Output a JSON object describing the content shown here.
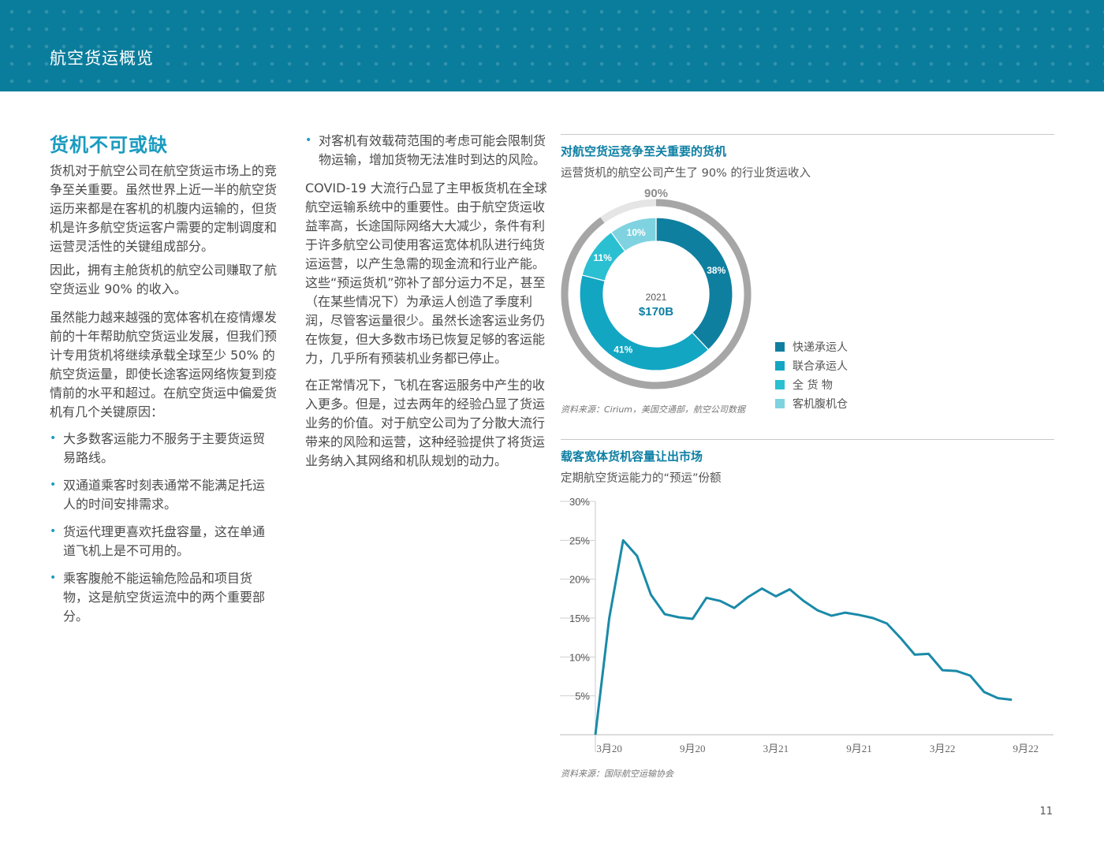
{
  "header": {
    "title": "航空货运概览"
  },
  "section": {
    "heading": "货机不可或缺",
    "para1": "货机对于航空公司在航空货运市场上的竞争至关重要。虽然世界上近一半的航空货运历来都是在客机的机腹内运输的，但货机是许多航空货运客户需要的定制调度和运营灵活性的关键组成部分。",
    "para2": "因此，拥有主舱货机的航空公司赚取了航空货运业 90% 的收入。",
    "para3": "虽然能力越来越强的宽体客机在疫情爆发前的十年帮助航空货运业发展，但我们预计专用货机将继续承载全球至少 50% 的航空货运量，即使长途客运网络恢复到疫情前的水平和超过。在航空货运中偏爱货机有几个关键原因：",
    "bullets": [
      "大多数客运能力不服务于主要货运贸易路线。",
      "双通道乘客时刻表通常不能满足托运人的时间安排需求。",
      "货运代理更喜欢托盘容量，这在单通道飞机上是不可用的。",
      "乘客腹舱不能运输危险品和项目货物，这是航空货运流中的两个重要部分。"
    ]
  },
  "col2": {
    "bullet": "对客机有效载荷范围的考虑可能会限制货物运输，增加货物无法准时到达的风险。",
    "para1": "COVID-19 大流行凸显了主甲板货机在全球航空运输系统中的重要性。由于航空货运收益率高，长途国际网络大大减少，条件有利于许多航空公司使用客运宽体机队进行纯货运运营，以产生急需的现金流和行业产能。这些“预运货机”弥补了部分运力不足，甚至（在某些情况下）为承运人创造了季度利润，尽管客运量很少。虽然长途客运业务仍在恢复，但大多数市场已恢复足够的客运能力，几乎所有预装机业务都已停止。",
    "para2": "在正常情况下，飞机在客运服务中产生的收入更多。但是，过去两年的经验凸显了货运业务的价值。对于航空公司为了分散大流行带来的风险和运营，这种经验提供了将货运业务纳入其网络和机队规划的动力。"
  },
  "donut": {
    "title": "对航空货运竞争至关重要的货机",
    "subtitle": "运营货机的航空公司产生了 90% 的行业货运收入",
    "outer_label": "90%",
    "center_year": "2021",
    "center_value": "$170B",
    "source": "资料来源：Cirium，美国交通部，航空公司数据"
  },
  "line": {
    "title": "载客宽体货机容量让出市场",
    "subtitle": "定期航空货运能力的“预运”份额",
    "source": "资料来源：国际航空运输协会"
  },
  "chart_data": [
    {
      "type": "pie",
      "title": "对航空货运竞争至关重要的货机",
      "categories": [
        "快递承运人",
        "联合承运人",
        "全 货 物",
        "客机腹机仓"
      ],
      "values": [
        38,
        41,
        11,
        10
      ],
      "labels": [
        "38%",
        "41%",
        "11%",
        "10%"
      ],
      "colors": [
        "#0f7fa0",
        "#12a6c3",
        "#2bbfd2",
        "#7fd3e0"
      ],
      "freighter_share_label": "90%",
      "freighter_share": 90,
      "freighter_ring_color": "#a6a6a6",
      "legend_position": "right"
    },
    {
      "type": "line",
      "title": "载客宽体货机容量让出市场",
      "x": [
        0,
        1,
        2,
        3,
        4,
        5,
        6,
        7,
        8,
        9,
        10,
        11,
        12,
        13,
        14,
        15,
        16,
        17,
        18,
        19,
        20,
        21,
        22,
        23,
        24,
        25,
        26,
        27,
        28,
        29,
        30,
        31
      ],
      "tick_labels": [
        "3月20",
        "9月20",
        "3月21",
        "9月21",
        "3月22",
        "9月22"
      ],
      "tick_positions": [
        1,
        7,
        13,
        19,
        25,
        31
      ],
      "values": [
        0,
        15,
        25,
        23,
        18,
        15.5,
        15.1,
        14.9,
        17.6,
        17.2,
        16.3,
        17.7,
        18.8,
        17.8,
        18.7,
        17.2,
        16.0,
        15.3,
        15.7,
        15.4,
        15.0,
        14.3,
        12.4,
        10.3,
        10.4,
        8.3,
        8.2,
        7.6,
        5.5,
        4.7,
        4.5
      ],
      "yticks": [
        "5%",
        "10%",
        "15%",
        "20%",
        "25%",
        "30%"
      ],
      "ylim": [
        0,
        30
      ],
      "xlim": [
        0,
        33
      ],
      "grid": "horizontal",
      "color": "#1a8aa8"
    }
  ],
  "page_number": "11"
}
